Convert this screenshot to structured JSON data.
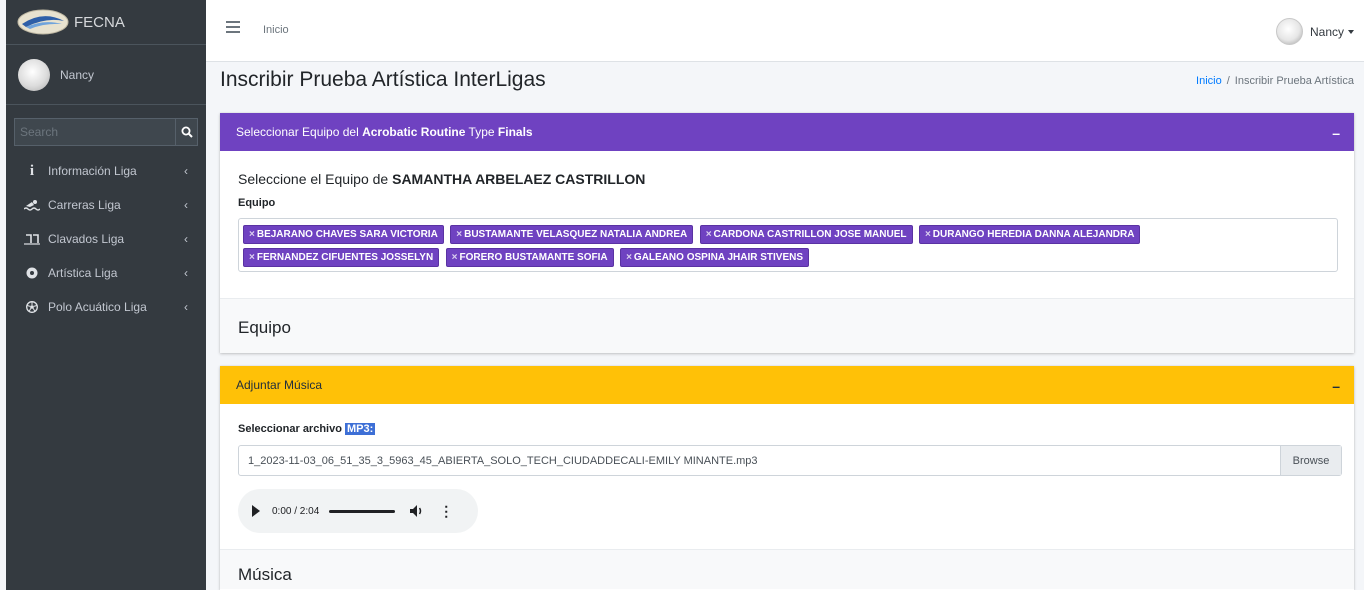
{
  "sidebar": {
    "brand": "FECNA",
    "user": "Nancy",
    "search_placeholder": "Search",
    "items": [
      {
        "label": "Información Liga",
        "icon": "info-icon"
      },
      {
        "label": "Carreras Liga",
        "icon": "swimmer-icon"
      },
      {
        "label": "Clavados Liga",
        "icon": "diving-icon"
      },
      {
        "label": "Artística Liga",
        "icon": "artistic-icon"
      },
      {
        "label": "Polo Acuático Liga",
        "icon": "water-polo-icon"
      }
    ]
  },
  "topbar": {
    "home": "Inicio",
    "user": "Nancy"
  },
  "page": {
    "title": "Inscribir Prueba Artística InterLigas",
    "breadcrumb": {
      "home": "Inicio",
      "sep": "/",
      "current": "Inscribir Prueba Artística"
    }
  },
  "team_card": {
    "header_prefix": "Seleccionar Equipo del ",
    "header_bold1": "Acrobatic Routine",
    "header_mid": " Type ",
    "header_bold2": "Finals",
    "select_prefix": "Seleccione el Equipo de ",
    "select_name": "SAMANTHA ARBELAEZ CASTRILLON",
    "label": "Equipo",
    "tags": [
      "BEJARANO CHAVES SARA VICTORIA",
      "BUSTAMANTE VELASQUEZ NATALIA ANDREA",
      "CARDONA CASTRILLON JOSE MANUEL",
      "DURANGO HEREDIA DANNA ALEJANDRA",
      "FERNANDEZ CIFUENTES JOSSELYN",
      "FORERO BUSTAMANTE SOFIA",
      "GALEANO OSPINA JHAIR STIVENS"
    ],
    "section_title": "Equipo"
  },
  "music_card": {
    "header": "Adjuntar Música",
    "file_label": "Seleccionar archivo ",
    "file_label_highlight": "MP3:",
    "file_name": "1_2023-11-03_06_51_35_3_5963_45_ABIERTA_SOLO_TECH_CIUDADDECALI-EMILY MINANTE.mp3",
    "browse": "Browse",
    "audio_time": "0:00 / 2:04",
    "section_title": "Música"
  },
  "colors": {
    "sidebar": "#343a40",
    "purple": "#6f42c1",
    "yellow": "#ffc107",
    "link": "#007bff"
  }
}
